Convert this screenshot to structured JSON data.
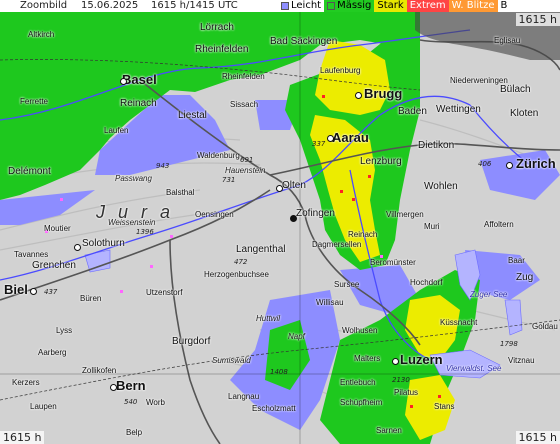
{
  "header": {
    "label": "Zoombild",
    "date": "15.06.2025",
    "time": "1615 h/1415 UTC",
    "legend": [
      {
        "name": "Leicht",
        "color": "#8f8fff"
      },
      {
        "name": "Mässig",
        "color": "#22cc22"
      },
      {
        "name": "Stark",
        "color": "#e8e800"
      },
      {
        "name": "Extrem",
        "color": "#ff4444"
      },
      {
        "name": "W. Blitze",
        "color": "#ff9933"
      },
      {
        "name": "B",
        "color": "#ffffff"
      }
    ]
  },
  "corners": {
    "top_right": "1615 h",
    "bottom_left": "1615 h",
    "bottom_right": "1615 h"
  },
  "places": {
    "zoombild": "Zoombild",
    "altkirch": "Altkirch",
    "lorrach": "Lörrach",
    "rheinfelden_de": "Rheinfelden",
    "bad_sackingen": "Bad Säckingen",
    "laufenburg": "Laufenburg",
    "basel": "Basel",
    "rheinfelden": "Rheinfelden",
    "niederweningen": "Niederweningen",
    "brugg": "Brugg",
    "baden": "Baden",
    "wettingen": "Wettingen",
    "bulach": "Bülach",
    "kloten": "Kloten",
    "reinach_bl": "Reinach",
    "liestal": "Liestal",
    "sissach": "Sissach",
    "ferrette": "Ferrette",
    "laufen": "Laufen",
    "aarau": "Aarau",
    "lenzburg": "Lenzburg",
    "dietikon": "Dietikon",
    "zurich": "Zürich",
    "waldenburg": "Waldenburg",
    "delemont": "Delémont",
    "passwang": "Passwang",
    "hauenstein": "Hauenstein",
    "olten": "Olten",
    "wohlen": "Wohlen",
    "balsthal": "Balsthal",
    "oensingen": "Oensingen",
    "zofingen": "Zofingen",
    "wohlen2": "Villmergen",
    "muri": "Muri",
    "affoltern": "Affoltern",
    "weissenstein": "Weissenstein",
    "moutier": "Moutier",
    "solothurn": "Solothurn",
    "langenthal": "Langenthal",
    "dagmersellen": "Dagmersellen",
    "reinach": "Reinach",
    "beromunster": "Beromünster",
    "tavannes": "Tavannes",
    "grenchen": "Grenchen",
    "herzogenbuchsee": "Herzogenbuchsee",
    "sursee": "Sursee",
    "hochdorf": "Hochdorf",
    "zug": "Zug",
    "biel": "Biel",
    "buren": "Büren",
    "utzenstorf": "Utzenstorf",
    "willisau": "Willisau",
    "kussnacht": "Küssnacht",
    "huttwil": "Huttwil",
    "wolhusen": "Wolhusen",
    "lyss": "Lyss",
    "burgdorf": "Burgdorf",
    "aarberg": "Aarberg",
    "zollikofen": "Zollikofen",
    "sumiswald": "Sumiswald",
    "napf": "Napf",
    "malters": "Malters",
    "luzern": "Luzern",
    "kerzers": "Kerzers",
    "bern": "Bern",
    "entlebuch": "Entlebuch",
    "pilatus": "Pilatus",
    "vitznau": "Vitznau",
    "worb": "Worb",
    "langnau": "Langnau",
    "escholzmatt": "Escholzmatt",
    "schupfheim": "Schüpfheim",
    "stans": "Stans",
    "sarnen": "Sarnen",
    "laupen": "Laupen",
    "belp": "Belp",
    "jura": "J u r a",
    "vierwald": "Vierwaldst. See",
    "zugersee": "Zuger See",
    "goldau": "Goldau",
    "eglisau": "Eglisau",
    "baar": "Baar"
  },
  "peaks": {
    "p943": "943",
    "p691": "691",
    "p1396": "1396",
    "p731": "731",
    "p472": "472",
    "p1408": "1408",
    "p2130": "2130",
    "p1798": "1798",
    "p337": "337",
    "p437": "437",
    "p540": "540",
    "p406": "406"
  }
}
